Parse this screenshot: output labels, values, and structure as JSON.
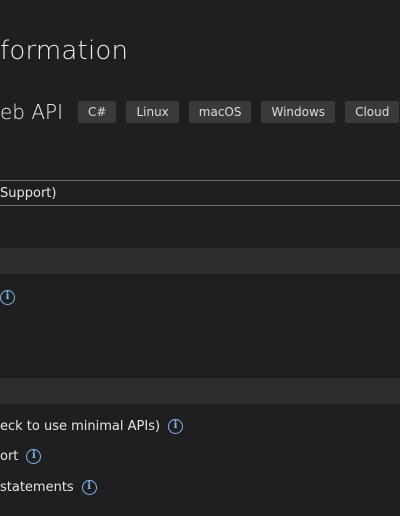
{
  "header": {
    "title": "formation",
    "subtitle": "eb API",
    "tags": [
      "C#",
      "Linux",
      "macOS",
      "Windows",
      "Cloud"
    ]
  },
  "framework": {
    "selected_value": "Support)"
  },
  "options": {
    "first_info_icon": "info-icon",
    "use_controllers_label": "eck to use minimal APIs)",
    "openapi_label": "ort",
    "top_level_statements_label": "statements"
  },
  "colors": {
    "background": "#1f1f1f",
    "section_bar": "#2d2d2d",
    "tag_bg": "#3a3a3a",
    "info_icon": "#7fb6f2"
  }
}
